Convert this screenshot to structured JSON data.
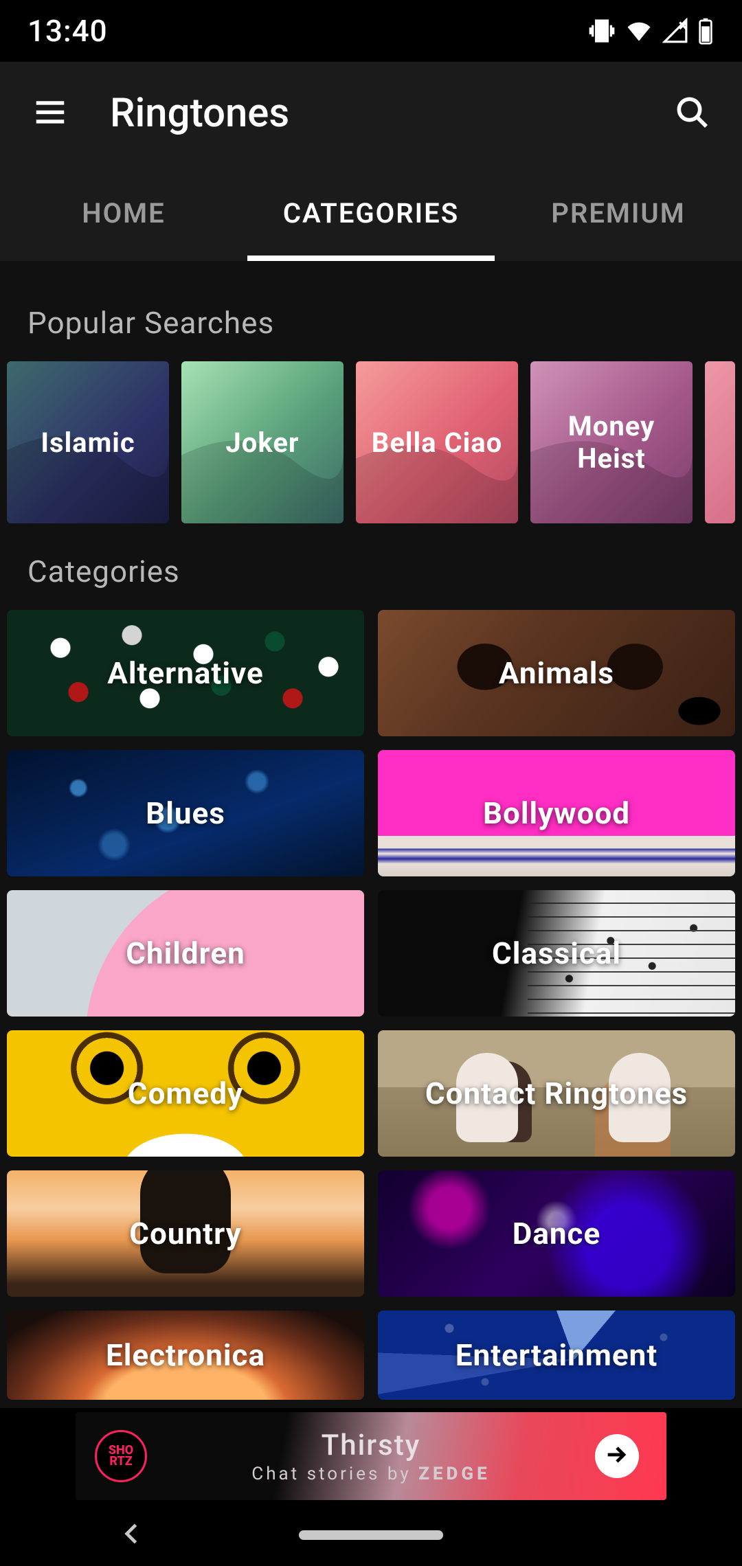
{
  "status": {
    "time": "13:40"
  },
  "header": {
    "title": "Ringtones"
  },
  "tabs": [
    {
      "label": "HOME",
      "active": false
    },
    {
      "label": "CATEGORIES",
      "active": true
    },
    {
      "label": "PREMIUM",
      "active": false
    }
  ],
  "popular": {
    "heading": "Popular Searches",
    "items": [
      {
        "label": "Islamic"
      },
      {
        "label": "Joker"
      },
      {
        "label": "Bella Ciao"
      },
      {
        "label": "Money Heist"
      }
    ]
  },
  "categories": {
    "heading": "Categories",
    "items": [
      {
        "label": "Alternative"
      },
      {
        "label": "Animals"
      },
      {
        "label": "Blues"
      },
      {
        "label": "Bollywood"
      },
      {
        "label": "Children"
      },
      {
        "label": "Classical"
      },
      {
        "label": "Comedy"
      },
      {
        "label": "Contact Ringtones"
      },
      {
        "label": "Country"
      },
      {
        "label": "Dance"
      },
      {
        "label": "Electronica"
      },
      {
        "label": "Entertainment"
      }
    ]
  },
  "ad": {
    "badge": "SHO\nRTZ",
    "title": "Thirsty",
    "subtitle_prefix": "Chat stories by ",
    "subtitle_brand": "ZEDGE"
  }
}
